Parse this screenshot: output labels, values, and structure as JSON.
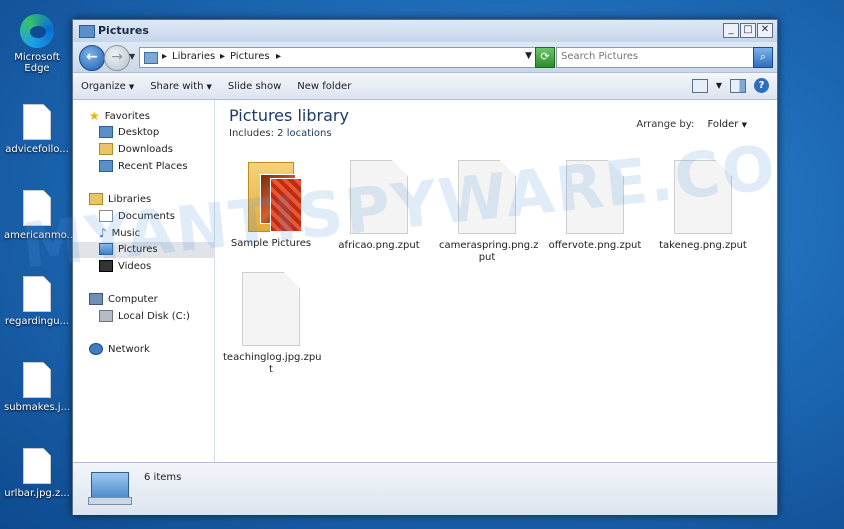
{
  "desktop": {
    "icons": [
      {
        "label": "Microsoft Edge"
      },
      {
        "label": "advicefollo..."
      },
      {
        "label": "americanmo..."
      },
      {
        "label": "regardingu..."
      },
      {
        "label": "submakes.j..."
      },
      {
        "label": "urlbar.jpg.z..."
      }
    ],
    "watermark": "MYANTISPYWARE.CO"
  },
  "window": {
    "title": "Pictures",
    "controls": {
      "minimize": "_",
      "maximize": "□",
      "close": "✕"
    },
    "address": {
      "crumbs": [
        "Libraries",
        "Pictures"
      ]
    },
    "search": {
      "placeholder": "Search Pictures"
    },
    "toolbar": {
      "organize": "Organize",
      "share_with": "Share with",
      "slide_show": "Slide show",
      "new_folder": "New folder"
    },
    "nav": {
      "favorites": "Favorites",
      "desktop": "Desktop",
      "downloads": "Downloads",
      "recent_places": "Recent Places",
      "libraries": "Libraries",
      "documents": "Documents",
      "music": "Music",
      "pictures": "Pictures",
      "videos": "Videos",
      "computer": "Computer",
      "local_disk": "Local Disk (C:)",
      "network": "Network"
    },
    "content": {
      "title": "Pictures library",
      "includes_label": "Includes:",
      "includes_value": "2 locations",
      "arrange_label": "Arrange by:",
      "arrange_value": "Folder",
      "items": [
        {
          "name": "Sample Pictures",
          "type": "folder"
        },
        {
          "name": "africao.png.zput",
          "type": "file"
        },
        {
          "name": "cameraspring.png.z put",
          "type": "file"
        },
        {
          "name": "offervote.png.zput",
          "type": "file"
        },
        {
          "name": "takeneg.png.zput",
          "type": "file"
        },
        {
          "name": "teachinglog.jpg.zpu t",
          "type": "file"
        }
      ]
    },
    "status": {
      "count": "6 items"
    }
  }
}
